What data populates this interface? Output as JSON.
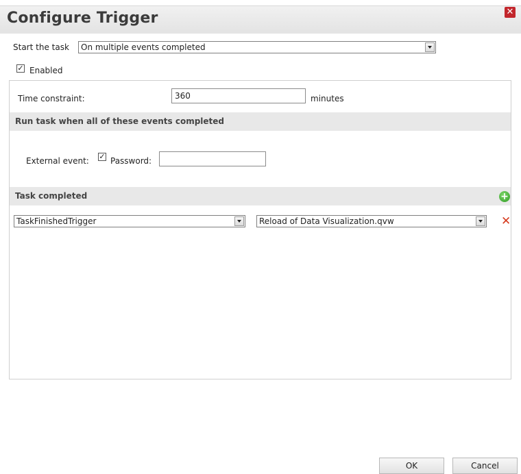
{
  "dialog": {
    "title": "Configure Trigger",
    "close_label": "✕"
  },
  "start": {
    "label": "Start the task",
    "selected": "On multiple events completed"
  },
  "enabled": {
    "label": "Enabled",
    "checked": true
  },
  "time": {
    "label": "Time constraint:",
    "value": "360",
    "unit": "minutes"
  },
  "events_section": {
    "header": "Run task when all of these events completed",
    "external_label": "External event:",
    "external_checked": true,
    "password_label": "Password:",
    "password_value": ""
  },
  "task_section": {
    "header": "Task completed",
    "add_icon": "plus-circle-icon",
    "remove_icon": "red-x-icon",
    "row": {
      "trigger": "TaskFinishedTrigger",
      "task": "Reload of Data Visualization.qvw"
    }
  },
  "footer": {
    "ok_label": "OK",
    "cancel_label": "Cancel"
  },
  "colors": {
    "close": "#c2262c",
    "add": "#2f9a24",
    "remove": "#d63a1e",
    "header_bg": "#e8e8e8"
  }
}
